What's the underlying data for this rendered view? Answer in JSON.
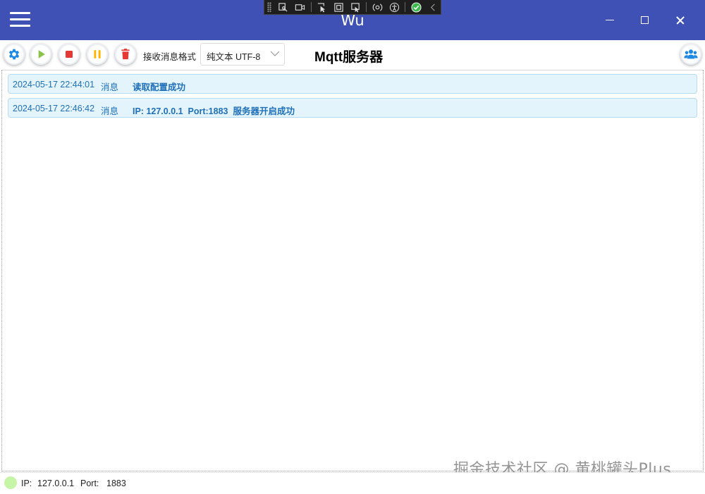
{
  "app": {
    "title": "Wu"
  },
  "titlebar": {
    "menu_icon": "hamburger-icon",
    "buttons": [
      "minimize-icon",
      "maximize-icon",
      "close-icon"
    ]
  },
  "dev_toolbar": {
    "icons": [
      "live-visual-tree-icon",
      "video-icon",
      "select-element-icon",
      "display-layout-adorners-icon",
      "track-focus-icon",
      "binding-failures-icon",
      "accessibility-icon",
      "check-circle-icon",
      "collapse-chevron-icon"
    ]
  },
  "toolbar": {
    "buttons": [
      {
        "icon": "gear-icon",
        "color": "#1e88e5"
      },
      {
        "icon": "play-icon",
        "color": "#8bc34a"
      },
      {
        "icon": "stop-icon",
        "color": "#e53935"
      },
      {
        "icon": "pause-icon",
        "color": "#ffb300"
      },
      {
        "icon": "trash-icon",
        "color": "#e53935"
      }
    ],
    "receive_format_label": "接收消息格式",
    "receive_format_value": "纯文本 UTF-8",
    "server_title": "Mqtt服务器",
    "users_icon": "users-icon",
    "users_color": "#1e88e5"
  },
  "log": [
    {
      "time": "2024-05-17 22:44:01",
      "type": "消息",
      "message": "读取配置成功"
    },
    {
      "time": "2024-05-17 22:46:42",
      "type": "消息",
      "message": "IP: 127.0.0.1  Port:1883  服务器开启成功"
    }
  ],
  "colors": {
    "titlebar": "#3f51b5",
    "log_text": "#1f6fb8",
    "log_bg": "#e3f4fd",
    "status_dot": "#c7f5a7"
  },
  "watermark": "掘金技术社区 @ 黄桃罐头Plus",
  "statusbar": {
    "ip_label": "IP:",
    "ip_value": "127.0.0.1",
    "port_label": "Port:",
    "port_value": "1883"
  }
}
